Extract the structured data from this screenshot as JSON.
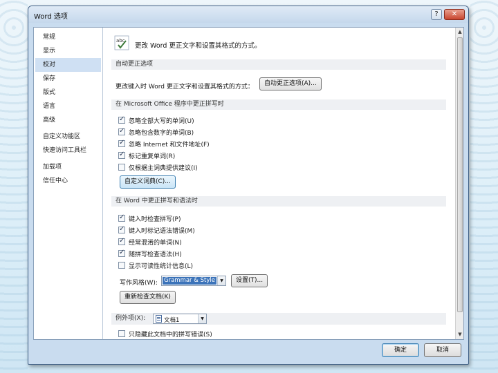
{
  "window": {
    "title": "Word 选项",
    "help_glyph": "?",
    "close_glyph": "✕"
  },
  "sidebar": {
    "items": [
      {
        "label": "常规",
        "active": false
      },
      {
        "label": "显示",
        "active": false
      },
      {
        "label": "校对",
        "active": true
      },
      {
        "label": "保存",
        "active": false
      },
      {
        "label": "版式",
        "active": false
      },
      {
        "label": "语言",
        "active": false
      },
      {
        "label": "高级",
        "active": false
      },
      {
        "label": "自定义功能区",
        "active": false
      },
      {
        "label": "快速访问工具栏",
        "active": false
      },
      {
        "label": "加载项",
        "active": false
      },
      {
        "label": "信任中心",
        "active": false
      }
    ]
  },
  "main": {
    "header": "更改 Word 更正文字和设置其格式的方式。",
    "autocorrect": {
      "section_title": "自动更正选项",
      "row_label": "更改键入时 Word 更正文字和设置其格式的方式：",
      "button": "自动更正选项(A)..."
    },
    "office_spelling": {
      "section_title": "在 Microsoft Office 程序中更正拼写时",
      "checkboxes": [
        {
          "label": "忽略全部大写的单词(U)",
          "checked": true
        },
        {
          "label": "忽略包含数字的单词(B)",
          "checked": true
        },
        {
          "label": "忽略 Internet 和文件地址(F)",
          "checked": true
        },
        {
          "label": "标记重复单词(R)",
          "checked": true
        },
        {
          "label": "仅根据主词典提供建议(I)",
          "checked": false
        }
      ],
      "custom_dict_button": "自定义词典(C)..."
    },
    "word_spelling": {
      "section_title": "在 Word 中更正拼写和语法时",
      "checkboxes": [
        {
          "label": "键入时检查拼写(P)",
          "checked": true
        },
        {
          "label": "键入时标记语法错误(M)",
          "checked": true
        },
        {
          "label": "经常混淆的单词(N)",
          "checked": true
        },
        {
          "label": "随拼写检查语法(H)",
          "checked": true
        },
        {
          "label": "显示可读性统计信息(L)",
          "checked": false
        }
      ],
      "writing_style_label": "写作风格(W):",
      "writing_style_value": "Grammar & Style",
      "settings_button": "设置(T)...",
      "recheck_button": "重新检查文档(K)"
    },
    "exceptions": {
      "label": "例外项(X):",
      "document_value": "文档1",
      "partial_checkbox": {
        "label": "只隐藏此文档中的拼写错误(S)",
        "checked": false
      }
    }
  },
  "footer": {
    "ok": "确定",
    "cancel": "取消"
  },
  "icons": {
    "header": "abc-proofing-icon",
    "combo_arrow": "▼",
    "scroll_up": "▲",
    "scroll_down": "▼"
  }
}
